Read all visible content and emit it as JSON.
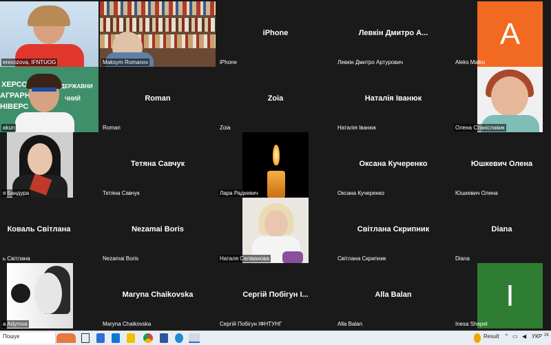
{
  "participants": [
    {
      "name": "erevozova, IFNTUOG"
    },
    {
      "name": "Maksym Romanov"
    },
    {
      "name": "iPhone",
      "display": "iPhone"
    },
    {
      "name": "Левкін Дмитро Артурович",
      "display": "Левкін Дмитро А..."
    },
    {
      "name": "Aleks Malko",
      "initial": "A"
    },
    {
      "name": "akun"
    },
    {
      "name": "Roman",
      "display": "Roman"
    },
    {
      "name": "Zoia",
      "display": "Zoia"
    },
    {
      "name": "Наталія Іванюк",
      "display": "Наталія Іванюк"
    },
    {
      "name": "Олена Станіславик"
    },
    {
      "name": "я Бандура"
    },
    {
      "name": "Тетяна Савчук",
      "display": "Тетяна Савчук"
    },
    {
      "name": "Лара Радкевич"
    },
    {
      "name": "Оксана Кучеренко",
      "display": "Оксана Кучеренко"
    },
    {
      "name": "Юшкевич Олена",
      "display": "Юшкевич Олена"
    },
    {
      "name": "ь Світлана",
      "display": "Коваль Світлана"
    },
    {
      "name": "Nezamai Boris",
      "display": "Nezamai Boris"
    },
    {
      "name": "Наталя Селіванова"
    },
    {
      "name": "Світлана Скрипник",
      "display": "Світлана Скрипник"
    },
    {
      "name": "Diana",
      "display": "Diana"
    },
    {
      "name": "a Adyrova"
    },
    {
      "name": "Maryna Chaikovska",
      "display": "Maryna Chaikovska"
    },
    {
      "name": "Сергій Побігун ІФНТУНГ",
      "display": "Сергій Побігун І..."
    },
    {
      "name": "Alla Balan",
      "display": "Alla Balan"
    },
    {
      "name": "Inesa Shepel",
      "initial": "I"
    }
  ],
  "photo_overlay": {
    "line1": "ХЕРСО",
    "line2": "АГРАРН",
    "line3": "НІВЕРС",
    "line4": "ДЕРЖАВНИ",
    "line5": "ЧНИЙ"
  },
  "taskbar": {
    "search_placeholder": "Пошук",
    "weather": "Result",
    "lang": "УКР",
    "clock": "26"
  },
  "colors": {
    "orange_avatar": "#f26a21",
    "green_avatar": "#2e7d32",
    "tile_bg": "#1a1a1a"
  }
}
